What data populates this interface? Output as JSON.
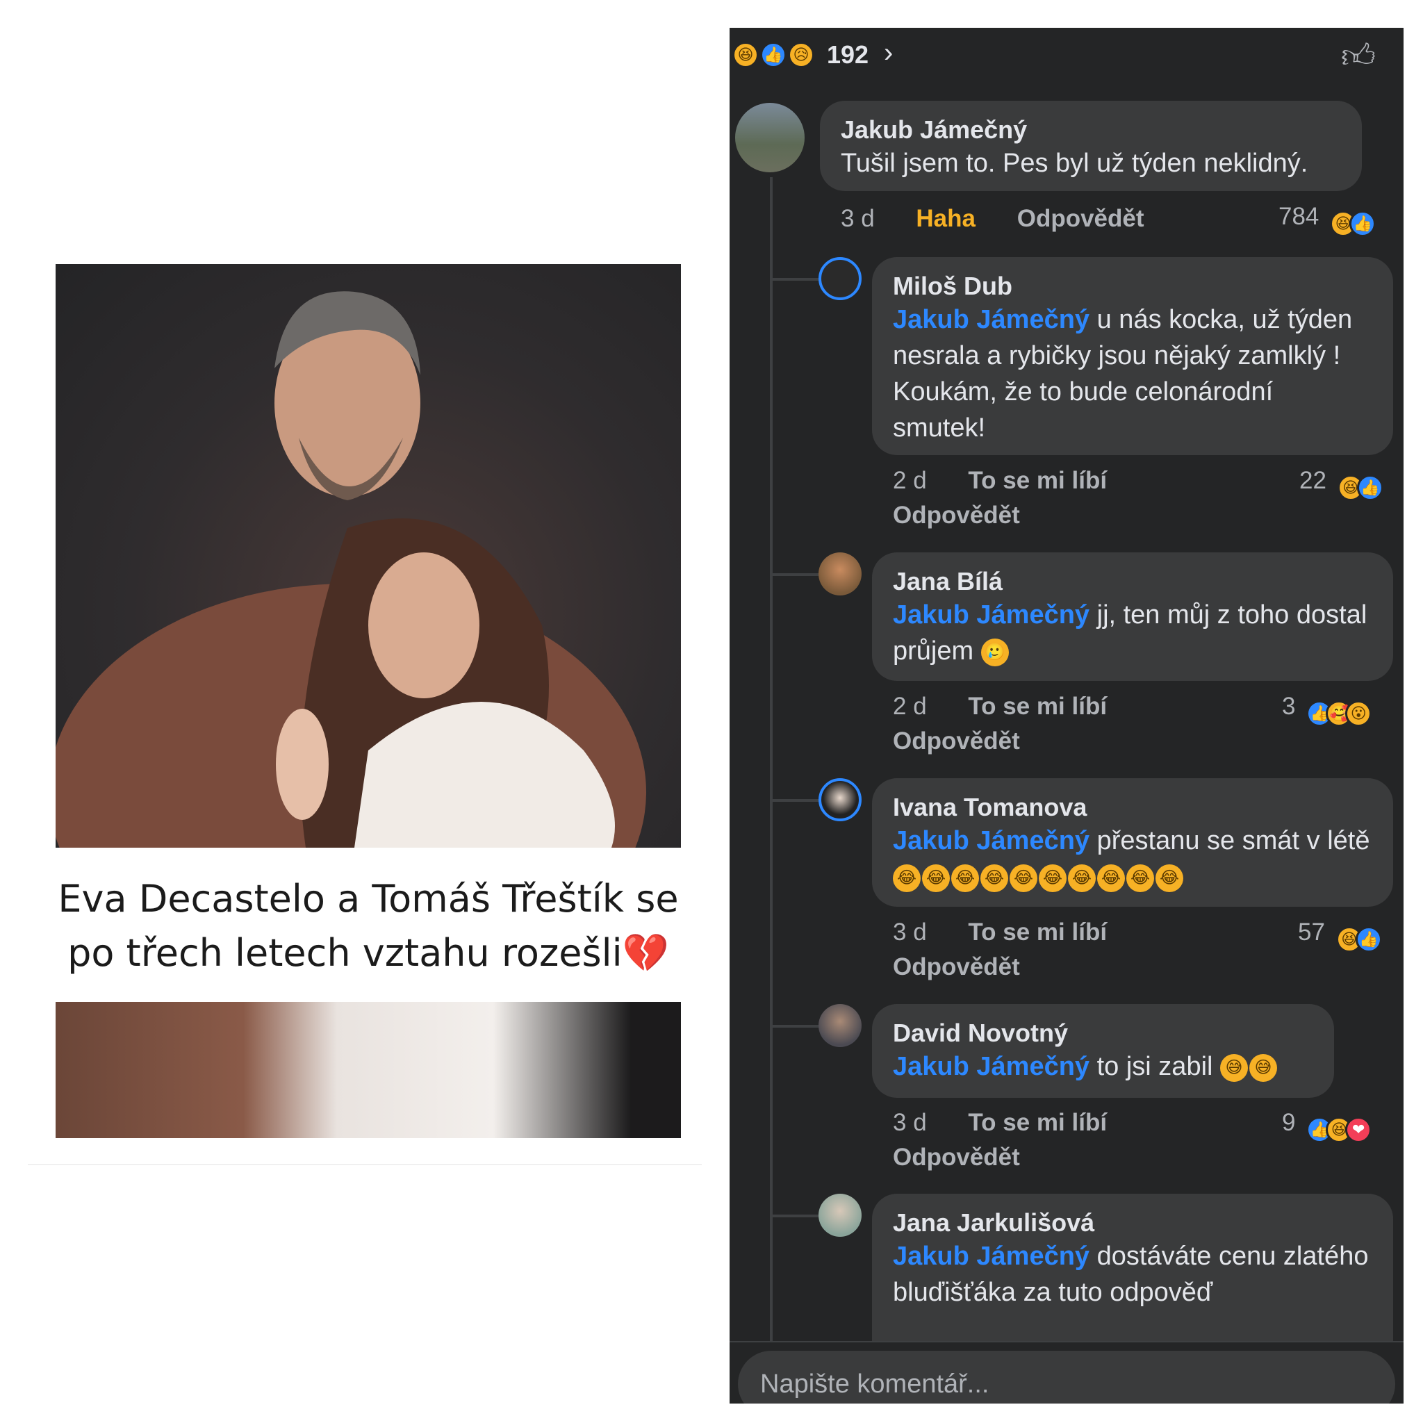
{
  "post": {
    "caption": "Eva Decastelo a Tomáš Třeštík se po třech letech vztahu rozešli",
    "caption_emoji": "💔"
  },
  "reactions_header": {
    "count": "192",
    "icons": [
      "haha-icon",
      "like-icon",
      "sad-icon"
    ]
  },
  "comments": [
    {
      "author": "Jakub Jámečný",
      "text": "Tušil jsem to. Pes byl už týden neklidný.",
      "time": "3 d",
      "reaction_label": "Haha",
      "reply_label": "Odpovědět",
      "reaction_count": "784"
    },
    {
      "author": "Miloš Dub",
      "mention": "Jakub Jámečný",
      "text": " u nás kocka, už týden nesrala a rybičky jsou nějaký zamlklý ! Koukám, že to bude celonárodní smutek!",
      "time": "2 d",
      "like_label": "To se mi líbí",
      "reply_label": "Odpovědět",
      "reaction_count": "22"
    },
    {
      "author": "Jana Bílá",
      "mention": "Jakub Jámečný",
      "text": " jj, ten můj z toho dostal průjem",
      "time": "2 d",
      "like_label": "To se mi líbí",
      "reply_label": "Odpovědět",
      "reaction_count": "3"
    },
    {
      "author": "Ivana Tomanova",
      "mention": "Jakub Jámečný",
      "text": " přestanu se smát v létě",
      "time": "3 d",
      "like_label": "To se mi líbí",
      "reply_label": "Odpovědět",
      "reaction_count": "57"
    },
    {
      "author": "David Novotný",
      "mention": "Jakub Jámečný",
      "text": " to jsi zabil",
      "time": "3 d",
      "like_label": "To se mi líbí",
      "reply_label": "Odpovědět",
      "reaction_count": "9"
    },
    {
      "author": "Jana Jarkulišová",
      "mention": "Jakub Jámečný",
      "text": " dostáváte cenu zlatého bluďišťáka za tuto odpověď"
    }
  ],
  "composer": {
    "placeholder": "Napište komentář..."
  },
  "colors": {
    "panel_bg": "#242526",
    "bubble_bg": "#3a3b3c",
    "mention": "#2d88ff",
    "haha": "#f7b125"
  }
}
